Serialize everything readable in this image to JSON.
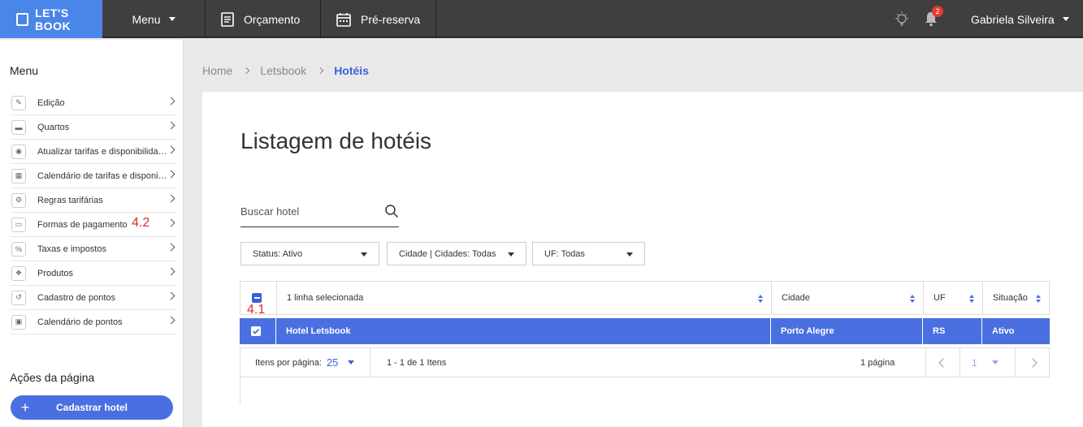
{
  "topbar": {
    "logo": "LET'S BOOK",
    "menu_label": "Menu",
    "nav": [
      {
        "label": "Orçamento",
        "icon": "document-icon"
      },
      {
        "label": "Pré-reserva",
        "icon": "calendar-icon"
      }
    ],
    "notification_count": "2",
    "user_name": "Gabriela Silveira"
  },
  "sidebar": {
    "title": "Menu",
    "items": [
      {
        "label": "Edição",
        "icon": "pencil-icon"
      },
      {
        "label": "Quartos",
        "icon": "bed-icon"
      },
      {
        "label": "Atualizar tarifas e disponibilidade",
        "icon": "refresh-icon"
      },
      {
        "label": "Calendário de tarifas e disponibilidade",
        "icon": "grid-icon"
      },
      {
        "label": "Regras tarifárias",
        "icon": "gears-icon"
      },
      {
        "label": "Formas de pagamento",
        "icon": "card-icon"
      },
      {
        "label": "Taxas e impostos",
        "icon": "percent-icon"
      },
      {
        "label": "Produtos",
        "icon": "products-icon"
      },
      {
        "label": "Cadastro de pontos",
        "icon": "history-icon"
      },
      {
        "label": "Calendário de pontos",
        "icon": "calendar-small-icon"
      }
    ],
    "annotation_item": "4.2",
    "actions_title": "Ações da página",
    "add_hotel_label": "Cadastrar hotel"
  },
  "breadcrumb": {
    "items": [
      "Home",
      "Letsbook"
    ],
    "current": "Hotéis"
  },
  "main": {
    "title": "Listagem de hotéis",
    "search_placeholder": "Buscar hotel",
    "filters": [
      {
        "label": "Status: Ativo"
      },
      {
        "label": "Cidade | Cidades: Todas"
      },
      {
        "label": "UF: Todas"
      }
    ],
    "table": {
      "columns": [
        "1 linha selecionada",
        "Cidade",
        "UF",
        "Situação"
      ],
      "annotation_header": "4.1",
      "rows": [
        {
          "name": "Hotel Letsbook",
          "city": "Porto Alegre",
          "uf": "RS",
          "status": "Ativo",
          "selected": true
        }
      ]
    },
    "pager": {
      "per_page_label": "Itens por página:",
      "per_page_value": "25",
      "range": "1 - 1 de 1 Itens",
      "pages": "1 página",
      "current_page": "1"
    }
  },
  "colors": {
    "topbar": "#3f3f3f",
    "accent": "#4a6fe0",
    "logo_bg": "#4a86e8",
    "annotation": "#d32f2f"
  }
}
